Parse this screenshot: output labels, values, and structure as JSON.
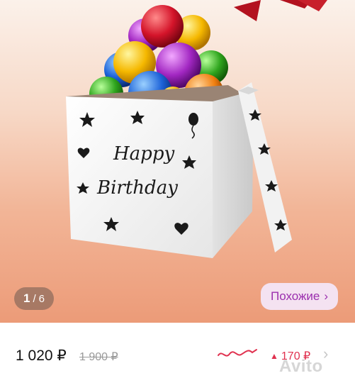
{
  "gallery": {
    "image_alt": "Gift box with balloons - Happy Birthday",
    "box_text_line1": "Happy",
    "box_text_line2": "Birthday",
    "counter": {
      "current": "1",
      "separator": "/",
      "total": "6"
    },
    "similar_label": "Похожие",
    "similar_chevron": "›"
  },
  "price": {
    "current": "1 020 ₽",
    "old": "1 900 ₽",
    "delta_arrow": "▲",
    "delta": "170 ₽",
    "trend_icon": "price-history-icon",
    "chevron": "›"
  },
  "watermark": "Avito",
  "colors": {
    "accent_pink": "#e0314f",
    "similar_bg": "#f4e2f1",
    "similar_text": "#9b2fae"
  }
}
